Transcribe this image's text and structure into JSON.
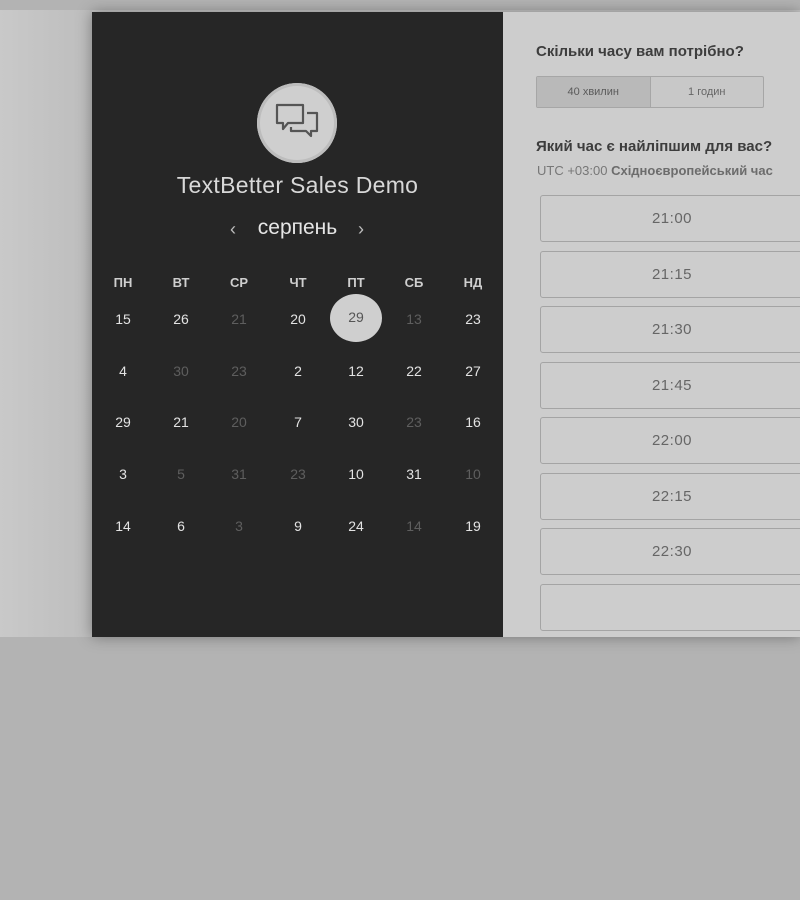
{
  "event": {
    "title": "TextBetter Sales Demo",
    "logo_icon": "chat-bubbles-icon"
  },
  "calendar": {
    "month": "серпень",
    "prev_icon": "‹",
    "next_icon": "›",
    "weekdays": [
      "ПН",
      "ВТ",
      "СР",
      "ЧТ",
      "ПТ",
      "СБ",
      "НД"
    ],
    "weeks": [
      [
        {
          "d": "15"
        },
        {
          "d": "26"
        },
        {
          "d": "21",
          "dim": true
        },
        {
          "d": "20"
        },
        {
          "d": "29",
          "selected": true
        },
        {
          "d": "13",
          "dim": true
        },
        {
          "d": "23"
        }
      ],
      [
        {
          "d": "4"
        },
        {
          "d": "30",
          "dim": true
        },
        {
          "d": "23",
          "dim": true
        },
        {
          "d": "2"
        },
        {
          "d": "12"
        },
        {
          "d": "22"
        },
        {
          "d": "27"
        }
      ],
      [
        {
          "d": "29"
        },
        {
          "d": "21"
        },
        {
          "d": "20",
          "dim": true
        },
        {
          "d": "7"
        },
        {
          "d": "30"
        },
        {
          "d": "23",
          "dim": true
        },
        {
          "d": "16"
        }
      ],
      [
        {
          "d": "3"
        },
        {
          "d": "5",
          "dim": true
        },
        {
          "d": "31",
          "dim": true
        },
        {
          "d": "23",
          "dim": true
        },
        {
          "d": "10"
        },
        {
          "d": "31"
        },
        {
          "d": "10",
          "dim": true
        }
      ],
      [
        {
          "d": "14"
        },
        {
          "d": "6"
        },
        {
          "d": "3",
          "dim": true
        },
        {
          "d": "9"
        },
        {
          "d": "24"
        },
        {
          "d": "14",
          "dim": true
        },
        {
          "d": "19"
        }
      ]
    ]
  },
  "duration": {
    "question": "Скільки часу вам потрібно?",
    "options": [
      "40 хвилин",
      "1 годин"
    ],
    "selected_index": 0
  },
  "timeslots": {
    "question": "Який час є найліпшим для вас?",
    "tz_offset": "UTC +03:00",
    "tz_name": "Східноєвропейський час",
    "slots": [
      "21:00",
      "21:15",
      "21:30",
      "21:45",
      "22:00",
      "22:15",
      "22:30"
    ]
  }
}
